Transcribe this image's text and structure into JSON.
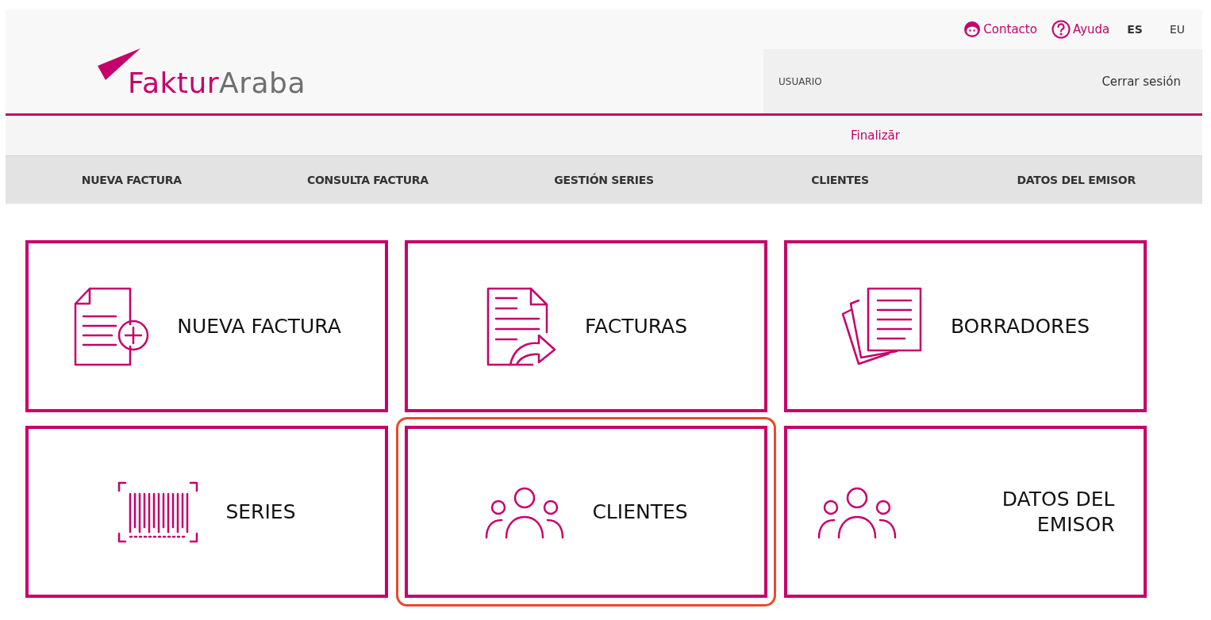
{
  "top_links": [
    {
      "kind": "contact",
      "label": "Contacto"
    },
    {
      "kind": "help",
      "label": "Ayuda"
    }
  ],
  "languages": [
    {
      "label": "ES",
      "selected": true
    },
    {
      "label": "EU",
      "selected": false
    }
  ],
  "logo": {
    "part_1": "Faktur",
    "part_2": "Araba"
  },
  "user_panel": {
    "user": "USUARIO",
    "logout": "Cerrar sesión"
  },
  "sub_bar": {
    "link": "Finalizār"
  },
  "nav": [
    "NUEVA FACTURA",
    "CONSULTA FACTURA",
    "GESTIÓN SERIES",
    "CLIENTES",
    "DATOS DEL EMISOR"
  ],
  "tiles": [
    {
      "kind": "new-doc",
      "label": "NUEVA FACTURA",
      "highlighted": false
    },
    {
      "kind": "share-doc",
      "label": "FACTURAS",
      "highlighted": false
    },
    {
      "kind": "stack-doc",
      "label": "BORRADORES",
      "highlighted": false
    },
    {
      "kind": "barcode",
      "label": "SERIES",
      "highlighted": false
    },
    {
      "kind": "people",
      "label": "CLIENTES",
      "highlighted": true
    },
    {
      "kind": "people",
      "label": "DATOS DEL EMISOR",
      "highlighted": false
    }
  ]
}
